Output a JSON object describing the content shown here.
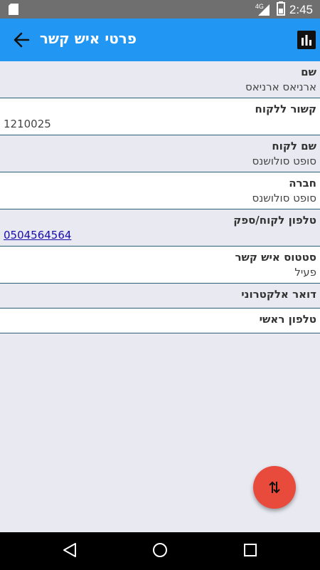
{
  "status_bar": {
    "network": "4G",
    "time": "2:45"
  },
  "app_bar": {
    "title": "פרטי איש קשר",
    "back_icon": "arrow-back-icon",
    "action_icon": "bar-chart-icon"
  },
  "fields": [
    {
      "label": "שם",
      "value": "ארניאס ארניאס"
    },
    {
      "label": "קשור ללקוח",
      "value": "1210025"
    },
    {
      "label": "שם לקוח",
      "value": "סופט סולושנס"
    },
    {
      "label": "חברה",
      "value": "סופט סולושנס"
    },
    {
      "label": "טלפון לקוח/ספק",
      "value": "0504564564"
    },
    {
      "label": "סטטוס איש קשר",
      "value": "פעיל"
    },
    {
      "label": "דואר אלקטרוני",
      "value": ""
    },
    {
      "label": "טלפון ראשי",
      "value": ""
    }
  ],
  "fab": {
    "icon": "swap-vertical-icon",
    "color": "#e84a3b"
  },
  "colors": {
    "appbar": "#2196f3",
    "row_shade": "#e8e9f1",
    "divider": "#2b5d75",
    "link": "#1a0dab"
  }
}
